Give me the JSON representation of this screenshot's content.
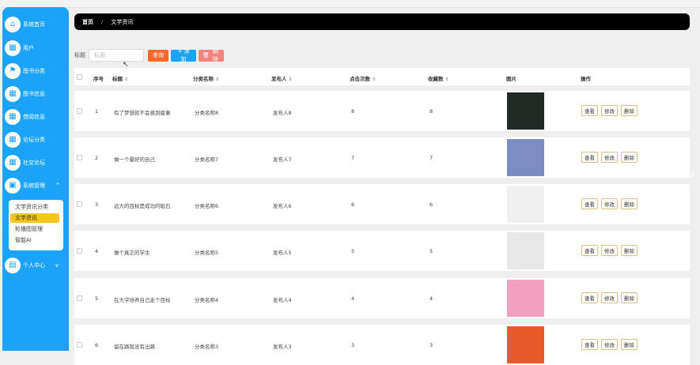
{
  "sidebar": {
    "items": [
      {
        "label": "系统首页",
        "icon": "home-icon"
      },
      {
        "label": "用户",
        "icon": "grid-icon"
      },
      {
        "label": "图书分类",
        "icon": "flag-icon"
      },
      {
        "label": "图书信息",
        "icon": "grid-icon"
      },
      {
        "label": "借阅信息",
        "icon": "grid-icon"
      },
      {
        "label": "论坛分类",
        "icon": "grid-icon"
      },
      {
        "label": "社交论坛",
        "icon": "grid-icon"
      },
      {
        "label": "系统管理",
        "icon": "briefcase-icon"
      },
      {
        "label": "个人中心",
        "icon": "card-icon"
      }
    ],
    "submenu": [
      "文学资讯分类",
      "文学资讯",
      "轮播图管理",
      "智能AI"
    ],
    "active_sub": "文学资讯"
  },
  "breadcrumb": {
    "home": "首页",
    "sep": "/",
    "current": "文学资讯"
  },
  "search": {
    "label": "标题",
    "placeholder": "标题"
  },
  "toolbar": {
    "query": "查询",
    "add": "+ 添加",
    "delete": "删除"
  },
  "columns": [
    "序号",
    "标题",
    "分类名称",
    "发布人",
    "点击次数",
    "收藏数",
    "图片",
    "操作"
  ],
  "rows": [
    {
      "no": "1",
      "title": "有了梦想就不会感到疲惫",
      "category": "分类名称8",
      "publisher": "发布人8",
      "clicks": "8",
      "favs": "8"
    },
    {
      "no": "2",
      "title": "做一个最好的自己",
      "category": "分类名称7",
      "publisher": "发布人7",
      "clicks": "7",
      "favs": "7"
    },
    {
      "no": "3",
      "title": "远大的目标是成功的砥石",
      "category": "分类名称6",
      "publisher": "发布人6",
      "clicks": "6",
      "favs": "6"
    },
    {
      "no": "4",
      "title": "做个真正的学生",
      "category": "分类名称5",
      "publisher": "发布人5",
      "clicks": "5",
      "favs": "5"
    },
    {
      "no": "5",
      "title": "在大学培养自己走个目标",
      "category": "分类名称4",
      "publisher": "发布人4",
      "clicks": "4",
      "favs": "4"
    },
    {
      "no": "6",
      "title": "留在路就没有出路",
      "category": "分类名称3",
      "publisher": "发布人3",
      "clicks": "3",
      "favs": "3"
    }
  ],
  "actions": {
    "view": "查看",
    "edit": "修改",
    "delete": "删除"
  },
  "thumb_colors": [
    "#1f2a25",
    "#7a8ec4",
    "#f0f0f0",
    "#e8e8e8",
    "#f2a0c0",
    "#e85a2a"
  ],
  "colors": {
    "sidebar": "#1aa3f7",
    "active_sub": "#f5c518",
    "query": "#ff6a28",
    "add": "#1aa3f7",
    "delete": "#f3847d"
  }
}
